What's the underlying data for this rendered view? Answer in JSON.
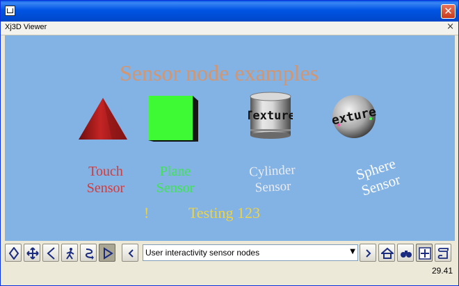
{
  "window": {
    "title": "",
    "panel_title": "Xj3D Viewer",
    "close_glyph": "✕",
    "panel_close_glyph": "×"
  },
  "scene": {
    "heading": "Sensor node examples",
    "touch": {
      "line1": "Touch",
      "line2": "Sensor",
      "color": "#d33b3b"
    },
    "plane": {
      "line1": "Plane",
      "line2": "Sensor",
      "color": "#3ee64f"
    },
    "cylinder": {
      "line1": "Cylinder",
      "line2": "Sensor",
      "texture_text": "Texture"
    },
    "sphere": {
      "line1": "Sphere",
      "line2": "Sensor",
      "texture_text": "exture"
    },
    "exclaim": "!",
    "testing": "Testing 123",
    "background_color": "#83b2e4"
  },
  "toolbar": {
    "buttons": [
      "tilt-icon",
      "pan-icon",
      "back-icon",
      "walk-icon",
      "examine-icon",
      "play-icon",
      "previous-viewpoint-icon",
      "next-viewpoint-icon",
      "home-icon",
      "fit-icon",
      "zoom-all-icon",
      "script-icon"
    ],
    "viewpoint_value": "User interactivity sensor nodes",
    "dropdown_arrow": "▼"
  },
  "status": {
    "fps": "29.41"
  }
}
